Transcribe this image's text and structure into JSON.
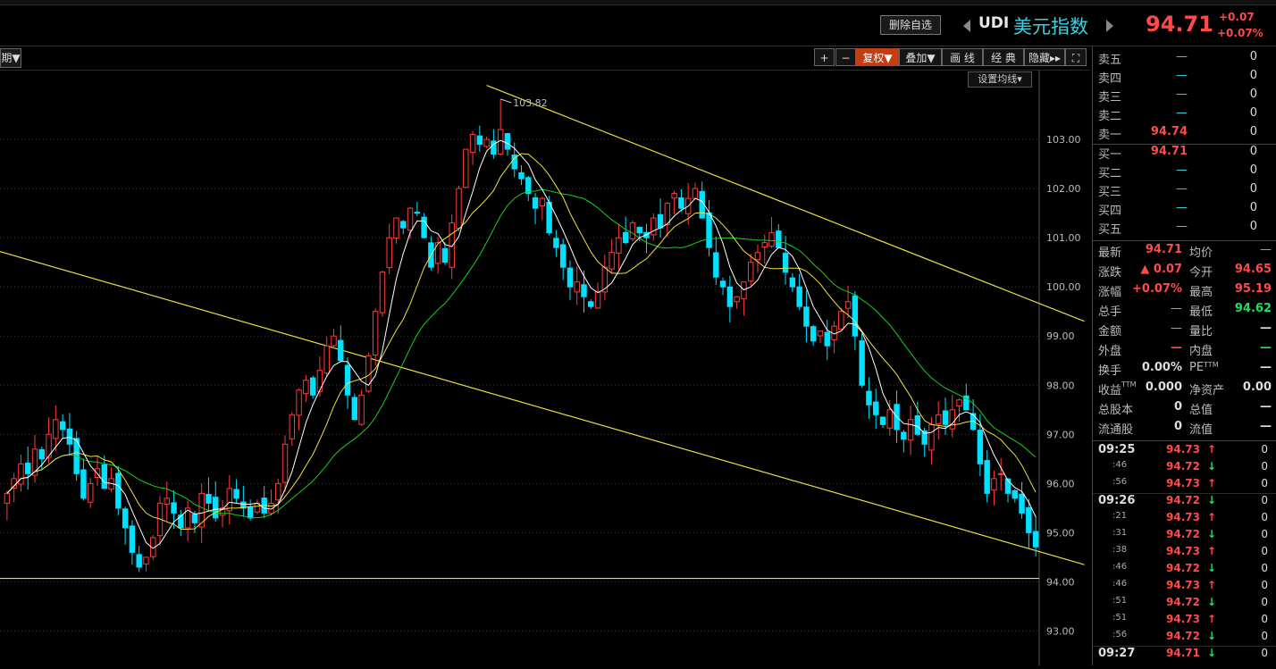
{
  "header": {
    "delete_button": "删除自选",
    "symbol": "UDI",
    "name": "美元指数",
    "price": "94.71",
    "change": "+0.07",
    "change_pct": "+0.07%"
  },
  "toolbar": {
    "period_label": "期▼",
    "zoom_in": "+",
    "zoom_out": "−",
    "fuquan": "复权▼",
    "overlay": "叠加▼",
    "draw_line": "画 线",
    "classic": "经 典",
    "hide": "隐藏▸▸",
    "fullscreen": "⛶",
    "ma_settings": "设置均线▾"
  },
  "chart_data": {
    "type": "candlestick",
    "y_ticks": [
      "103.00",
      "102.00",
      "101.00",
      "100.00",
      "99.00",
      "98.00",
      "97.00",
      "96.00",
      "95.00",
      "94.00",
      "93.00"
    ],
    "ylim": [
      92.3,
      104.4
    ],
    "high_marker": "103.82",
    "support_level": 94.07,
    "colors": {
      "up": "#ff3b3b",
      "down": "#00e0ff",
      "ma5": "#ffffff",
      "ma10": "#f0e040",
      "ma20": "#18d018",
      "trend": "#e8e040",
      "grid": "#3a3a3a"
    },
    "close": [
      95.8,
      96.1,
      96.4,
      96.2,
      96.7,
      96.5,
      97.0,
      97.3,
      97.1,
      96.8,
      96.2,
      95.7,
      96.0,
      96.3,
      95.9,
      96.1,
      95.5,
      95.1,
      94.6,
      94.3,
      94.5,
      94.9,
      95.6,
      95.7,
      95.4,
      95.1,
      95.5,
      95.2,
      95.8,
      95.6,
      95.3,
      95.5,
      95.9,
      95.7,
      95.5,
      95.3,
      95.6,
      95.4,
      95.6,
      96.0,
      96.8,
      97.4,
      97.9,
      98.1,
      97.8,
      98.3,
      98.8,
      99.0,
      98.5,
      97.8,
      97.3,
      97.8,
      98.6,
      99.5,
      100.3,
      101.0,
      101.4,
      101.2,
      101.6,
      101.5,
      101.0,
      100.4,
      100.9,
      100.5,
      101.3,
      102.0,
      102.8,
      103.1,
      102.9,
      103.0,
      102.7,
      103.2,
      102.8,
      102.4,
      102.2,
      101.9,
      101.6,
      101.8,
      101.1,
      100.8,
      100.4,
      100.0,
      100.1,
      99.8,
      99.6,
      99.9,
      100.4,
      100.7,
      101.0,
      100.9,
      101.3,
      101.1,
      101.0,
      101.4,
      101.2,
      101.7,
      101.9,
      101.6,
      101.8,
      102.0,
      101.4,
      100.8,
      100.2,
      100.0,
      99.6,
      99.8,
      100.1,
      100.5,
      100.7,
      100.9,
      101.1,
      100.8,
      100.3,
      100.0,
      99.6,
      99.2,
      98.9,
      99.1,
      98.8,
      99.2,
      99.5,
      99.7,
      99.0,
      98.0,
      97.6,
      97.4,
      97.2,
      97.5,
      97.1,
      96.9,
      97.3,
      97.0,
      96.8,
      97.2,
      97.4,
      97.2,
      97.5,
      97.7,
      97.5,
      97.1,
      96.4,
      95.8,
      96.1,
      96.2,
      95.8,
      95.7,
      95.4,
      95.0,
      94.71
    ],
    "series": [
      {
        "name": "MA5"
      },
      {
        "name": "MA10"
      },
      {
        "name": "MA20"
      }
    ],
    "trend_lines": [
      {
        "from": {
          "bar": -3,
          "price": 100.8
        },
        "to": {
          "bar": 155,
          "price": 94.35
        }
      },
      {
        "from": {
          "bar": 69,
          "price": 104.1
        },
        "to": {
          "bar": 155,
          "price": 99.3
        }
      }
    ]
  },
  "order_book": [
    {
      "label": "卖五",
      "price": "—",
      "vol": "0"
    },
    {
      "label": "卖四",
      "price": "—",
      "vol": "0"
    },
    {
      "label": "卖三",
      "price": "—",
      "vol": "0"
    },
    {
      "label": "卖二",
      "price": "—",
      "vol": "0"
    },
    {
      "label": "卖一",
      "price": "94.74",
      "vol": "0"
    },
    {
      "label": "买一",
      "price": "94.71",
      "vol": "0"
    },
    {
      "label": "买二",
      "price": "—",
      "vol": "0"
    },
    {
      "label": "买三",
      "price": "—",
      "vol": "0"
    },
    {
      "label": "买四",
      "price": "—",
      "vol": "0"
    },
    {
      "label": "买五",
      "price": "—",
      "vol": "0"
    }
  ],
  "stats": [
    {
      "l1": "最新",
      "v1": "94.71",
      "c1": "red",
      "l2": "均价",
      "v2": "—",
      "c2": "dash"
    },
    {
      "l1": "涨跌",
      "v1": "▲ 0.07",
      "c1": "red",
      "l2": "今开",
      "v2": "94.65",
      "c2": "red"
    },
    {
      "l1": "涨幅",
      "v1": "+0.07%",
      "c1": "red",
      "l2": "最高",
      "v2": "95.19",
      "c2": "red"
    },
    {
      "l1": "总手",
      "v1": "—",
      "c1": "dash",
      "l2": "最低",
      "v2": "94.62",
      "c2": "green"
    },
    {
      "l1": "金额",
      "v1": "—",
      "c1": "dash",
      "l2": "量比",
      "v2": "—",
      "c2": "white"
    },
    {
      "l1": "外盘",
      "v1": "—",
      "c1": "red",
      "l2": "内盘",
      "v2": "—",
      "c2": "green"
    },
    {
      "l1": "换手",
      "v1": "0.00%",
      "c1": "white",
      "l2": "PE",
      "v2": "—",
      "c2": "white"
    },
    {
      "l1": "收益",
      "v1": "0.000",
      "c1": "white",
      "l2": "净资产",
      "v2": "0.00",
      "c2": "white"
    },
    {
      "l1": "总股本",
      "v1": "0",
      "c1": "white",
      "l2": "总值",
      "v2": "—",
      "c2": "white"
    },
    {
      "l1": "流通股",
      "v1": "0",
      "c1": "white",
      "l2": "流值",
      "v2": "—",
      "c2": "white"
    }
  ],
  "stat_superscripts": {
    "ttm": "TTM"
  },
  "ticks": [
    {
      "time": "09:25",
      "main": true,
      "price": "94.73",
      "dir": "up",
      "vol": "0"
    },
    {
      "time": ":46",
      "main": false,
      "price": "94.72",
      "dir": "down",
      "vol": "0"
    },
    {
      "time": ":56",
      "main": false,
      "price": "94.73",
      "dir": "up",
      "vol": "0"
    },
    {
      "time": "09:26",
      "main": true,
      "price": "94.72",
      "dir": "down",
      "vol": "0"
    },
    {
      "time": ":21",
      "main": false,
      "price": "94.73",
      "dir": "up",
      "vol": "0"
    },
    {
      "time": ":31",
      "main": false,
      "price": "94.72",
      "dir": "down",
      "vol": "0"
    },
    {
      "time": ":38",
      "main": false,
      "price": "94.73",
      "dir": "up",
      "vol": "0"
    },
    {
      "time": ":46",
      "main": false,
      "price": "94.72",
      "dir": "down",
      "vol": "0"
    },
    {
      "time": ":46",
      "main": false,
      "price": "94.73",
      "dir": "up",
      "vol": "0"
    },
    {
      "time": ":51",
      "main": false,
      "price": "94.72",
      "dir": "down",
      "vol": "0"
    },
    {
      "time": ":51",
      "main": false,
      "price": "94.73",
      "dir": "up",
      "vol": "0"
    },
    {
      "time": ":56",
      "main": false,
      "price": "94.72",
      "dir": "down",
      "vol": "0"
    },
    {
      "time": "09:27",
      "main": true,
      "price": "94.71",
      "dir": "down",
      "vol": "0"
    }
  ]
}
